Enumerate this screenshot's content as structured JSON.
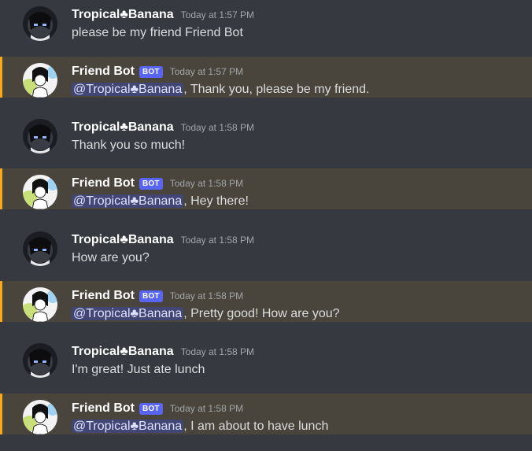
{
  "users": {
    "tropical": {
      "name": "Tropical♣Banana"
    },
    "bot": {
      "name": "Friend Bot",
      "tag": "BOT"
    }
  },
  "messages": [
    {
      "author": "Tropical♣Banana",
      "time": "Today at 1:57 PM",
      "text": "please be my friend Friend Bot"
    },
    {
      "author": "Friend Bot",
      "tag": "BOT",
      "time": "Today at 1:57 PM",
      "mention": "@Tropical♣Banana",
      "text": ", Thank you, please be my friend."
    },
    {
      "author": "Tropical♣Banana",
      "time": "Today at 1:58 PM",
      "text": "Thank you so much!"
    },
    {
      "author": "Friend Bot",
      "tag": "BOT",
      "time": "Today at 1:58 PM",
      "mention": "@Tropical♣Banana",
      "text": ", Hey there!"
    },
    {
      "author": "Tropical♣Banana",
      "time": "Today at 1:58 PM",
      "text": "How are you?"
    },
    {
      "author": "Friend Bot",
      "tag": "BOT",
      "time": "Today at 1:58 PM",
      "mention": "@Tropical♣Banana",
      "text": ", Pretty good! How are you?"
    },
    {
      "author": "Tropical♣Banana",
      "time": "Today at 1:58 PM",
      "text": "I'm great! Just ate lunch"
    },
    {
      "author": "Friend Bot",
      "tag": "BOT",
      "time": "Today at 1:58 PM",
      "mention": "@Tropical♣Banana",
      "text": ", I am about to have lunch"
    }
  ],
  "colors": {
    "background": "#36393f",
    "mention_highlight": "#49443c",
    "mention_bar": "#faa81a",
    "bot_tag": "#5865f2",
    "mention_pill": "#414675"
  }
}
